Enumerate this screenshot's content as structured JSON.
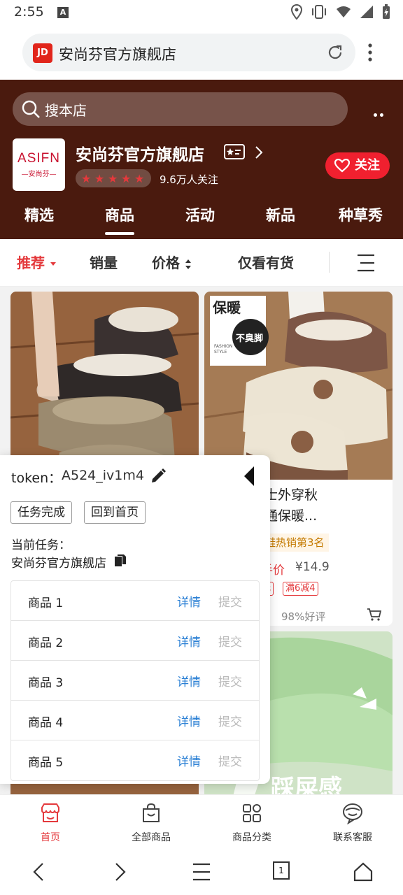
{
  "status_bar": {
    "time": "2:55",
    "indicator": "A"
  },
  "browser": {
    "logo_text": "JD",
    "title": "安尚芬官方旗舰店"
  },
  "store": {
    "search_placeholder": "搜本店",
    "logo_main": "ASIFN",
    "logo_sub": "—安尚芬—",
    "name": "安尚芬官方旗舰店",
    "followers": "9.6万人关注",
    "rating_stars": 4.5,
    "follow_label": "关注",
    "tabs": [
      "精选",
      "商品",
      "活动",
      "新品",
      "种草秀"
    ],
    "active_tab": "商品"
  },
  "sort": {
    "items": [
      "推荐",
      "销量",
      "价格",
      "仅看有货"
    ],
    "active": "推荐",
    "accent_color": "#e4393c"
  },
  "products": [
    {
      "image_text": []
    },
    {
      "image_text": [
        "保暖",
        "不臭脚",
        "FASHION",
        "STYLE"
      ],
      "title_line1": "棉拖鞋女士外穿秋",
      "title_line2": "家居家卡通保暖...",
      "rank_tag": "棉鞋热销第3名",
      "price_label": "到手价",
      "price": "¥14.9",
      "coupon1": "元",
      "coupon2": "满6减4",
      "review": "98%好评"
    },
    {
      "image_text": [
        "踩屎感"
      ]
    }
  ],
  "task_panel": {
    "token_label": "token：",
    "token_value": "A524_iv1m4",
    "complete_button": "任务完成",
    "home_button": "回到首页",
    "current_task_label": "当前任务：",
    "current_task_value": "安尚芬官方旗舰店",
    "tasks": [
      {
        "name": "商品 1",
        "detail": "详情",
        "submit": "提交"
      },
      {
        "name": "商品 2",
        "detail": "详情",
        "submit": "提交"
      },
      {
        "name": "商品 3",
        "detail": "详情",
        "submit": "提交"
      },
      {
        "name": "商品 4",
        "detail": "详情",
        "submit": "提交"
      },
      {
        "name": "商品 5",
        "detail": "详情",
        "submit": "提交"
      }
    ]
  },
  "bottom_nav": {
    "items": [
      {
        "label": "首页",
        "icon": "shop-icon"
      },
      {
        "label": "全部商品",
        "icon": "bag-icon"
      },
      {
        "label": "商品分类",
        "icon": "grid-icon"
      },
      {
        "label": "联系客服",
        "icon": "chat-icon"
      }
    ],
    "active": "首页"
  },
  "android_nav": {
    "tab_count": "1"
  }
}
